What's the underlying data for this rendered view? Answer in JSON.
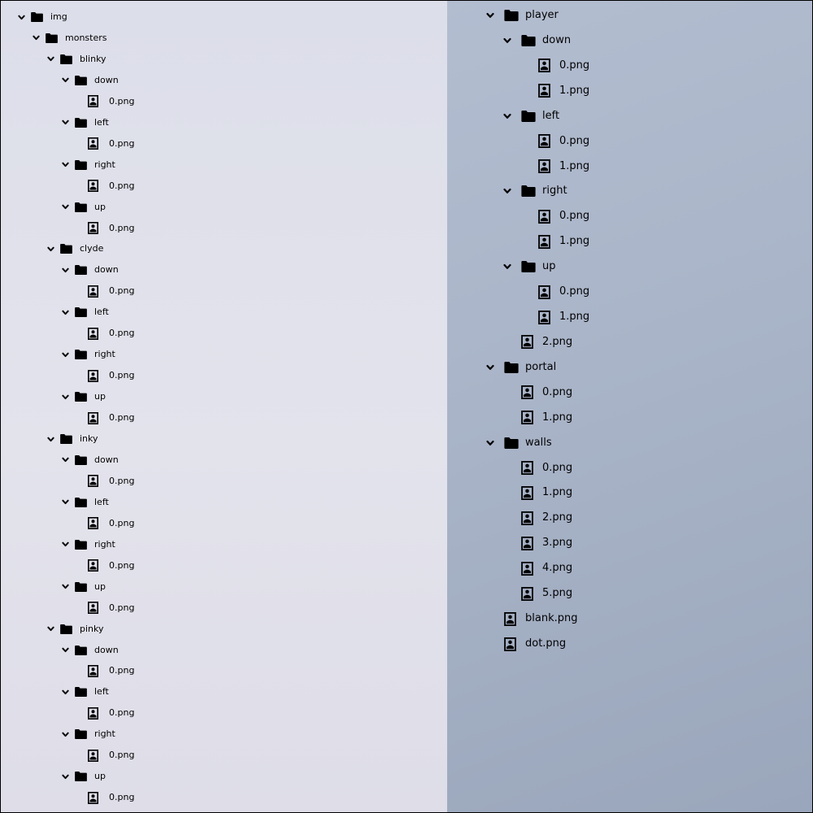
{
  "left_tree": {
    "items": [
      {
        "label": "img",
        "depth": 0,
        "type": "folder"
      },
      {
        "label": "monsters",
        "depth": 1,
        "type": "folder"
      },
      {
        "label": "blinky",
        "depth": 2,
        "type": "folder"
      },
      {
        "label": "down",
        "depth": 3,
        "type": "folder"
      },
      {
        "label": "0.png",
        "depth": 4,
        "type": "file"
      },
      {
        "label": "left",
        "depth": 3,
        "type": "folder"
      },
      {
        "label": "0.png",
        "depth": 4,
        "type": "file"
      },
      {
        "label": "right",
        "depth": 3,
        "type": "folder"
      },
      {
        "label": "0.png",
        "depth": 4,
        "type": "file"
      },
      {
        "label": "up",
        "depth": 3,
        "type": "folder"
      },
      {
        "label": "0.png",
        "depth": 4,
        "type": "file"
      },
      {
        "label": "clyde",
        "depth": 2,
        "type": "folder"
      },
      {
        "label": "down",
        "depth": 3,
        "type": "folder"
      },
      {
        "label": "0.png",
        "depth": 4,
        "type": "file"
      },
      {
        "label": "left",
        "depth": 3,
        "type": "folder"
      },
      {
        "label": "0.png",
        "depth": 4,
        "type": "file"
      },
      {
        "label": "right",
        "depth": 3,
        "type": "folder"
      },
      {
        "label": "0.png",
        "depth": 4,
        "type": "file"
      },
      {
        "label": "up",
        "depth": 3,
        "type": "folder"
      },
      {
        "label": "0.png",
        "depth": 4,
        "type": "file"
      },
      {
        "label": "inky",
        "depth": 2,
        "type": "folder"
      },
      {
        "label": "down",
        "depth": 3,
        "type": "folder"
      },
      {
        "label": "0.png",
        "depth": 4,
        "type": "file"
      },
      {
        "label": "left",
        "depth": 3,
        "type": "folder"
      },
      {
        "label": "0.png",
        "depth": 4,
        "type": "file"
      },
      {
        "label": "right",
        "depth": 3,
        "type": "folder"
      },
      {
        "label": "0.png",
        "depth": 4,
        "type": "file"
      },
      {
        "label": "up",
        "depth": 3,
        "type": "folder"
      },
      {
        "label": "0.png",
        "depth": 4,
        "type": "file"
      },
      {
        "label": "pinky",
        "depth": 2,
        "type": "folder"
      },
      {
        "label": "down",
        "depth": 3,
        "type": "folder"
      },
      {
        "label": "0.png",
        "depth": 4,
        "type": "file"
      },
      {
        "label": "left",
        "depth": 3,
        "type": "folder"
      },
      {
        "label": "0.png",
        "depth": 4,
        "type": "file"
      },
      {
        "label": "right",
        "depth": 3,
        "type": "folder"
      },
      {
        "label": "0.png",
        "depth": 4,
        "type": "file"
      },
      {
        "label": "up",
        "depth": 3,
        "type": "folder"
      },
      {
        "label": "0.png",
        "depth": 4,
        "type": "file"
      }
    ]
  },
  "right_tree": {
    "items": [
      {
        "label": "player",
        "depth": 0,
        "type": "folder"
      },
      {
        "label": "down",
        "depth": 1,
        "type": "folder"
      },
      {
        "label": "0.png",
        "depth": 2,
        "type": "file"
      },
      {
        "label": "1.png",
        "depth": 2,
        "type": "file"
      },
      {
        "label": "left",
        "depth": 1,
        "type": "folder"
      },
      {
        "label": "0.png",
        "depth": 2,
        "type": "file"
      },
      {
        "label": "1.png",
        "depth": 2,
        "type": "file"
      },
      {
        "label": "right",
        "depth": 1,
        "type": "folder"
      },
      {
        "label": "0.png",
        "depth": 2,
        "type": "file"
      },
      {
        "label": "1.png",
        "depth": 2,
        "type": "file"
      },
      {
        "label": "up",
        "depth": 1,
        "type": "folder"
      },
      {
        "label": "0.png",
        "depth": 2,
        "type": "file"
      },
      {
        "label": "1.png",
        "depth": 2,
        "type": "file"
      },
      {
        "label": "2.png",
        "depth": 1,
        "type": "file"
      },
      {
        "label": "portal",
        "depth": 0,
        "type": "folder"
      },
      {
        "label": "0.png",
        "depth": 1,
        "type": "file"
      },
      {
        "label": "1.png",
        "depth": 1,
        "type": "file"
      },
      {
        "label": "walls",
        "depth": 0,
        "type": "folder"
      },
      {
        "label": "0.png",
        "depth": 1,
        "type": "file"
      },
      {
        "label": "1.png",
        "depth": 1,
        "type": "file"
      },
      {
        "label": "2.png",
        "depth": 1,
        "type": "file"
      },
      {
        "label": "3.png",
        "depth": 1,
        "type": "file"
      },
      {
        "label": "4.png",
        "depth": 1,
        "type": "file"
      },
      {
        "label": "5.png",
        "depth": 1,
        "type": "file"
      },
      {
        "label": "blank.png",
        "depth": 0,
        "type": "file"
      },
      {
        "label": "dot.png",
        "depth": 0,
        "type": "file"
      }
    ]
  },
  "icons": {
    "folder": "folder-icon",
    "file": "image-file-icon",
    "expanded": "chevron-down-icon"
  }
}
